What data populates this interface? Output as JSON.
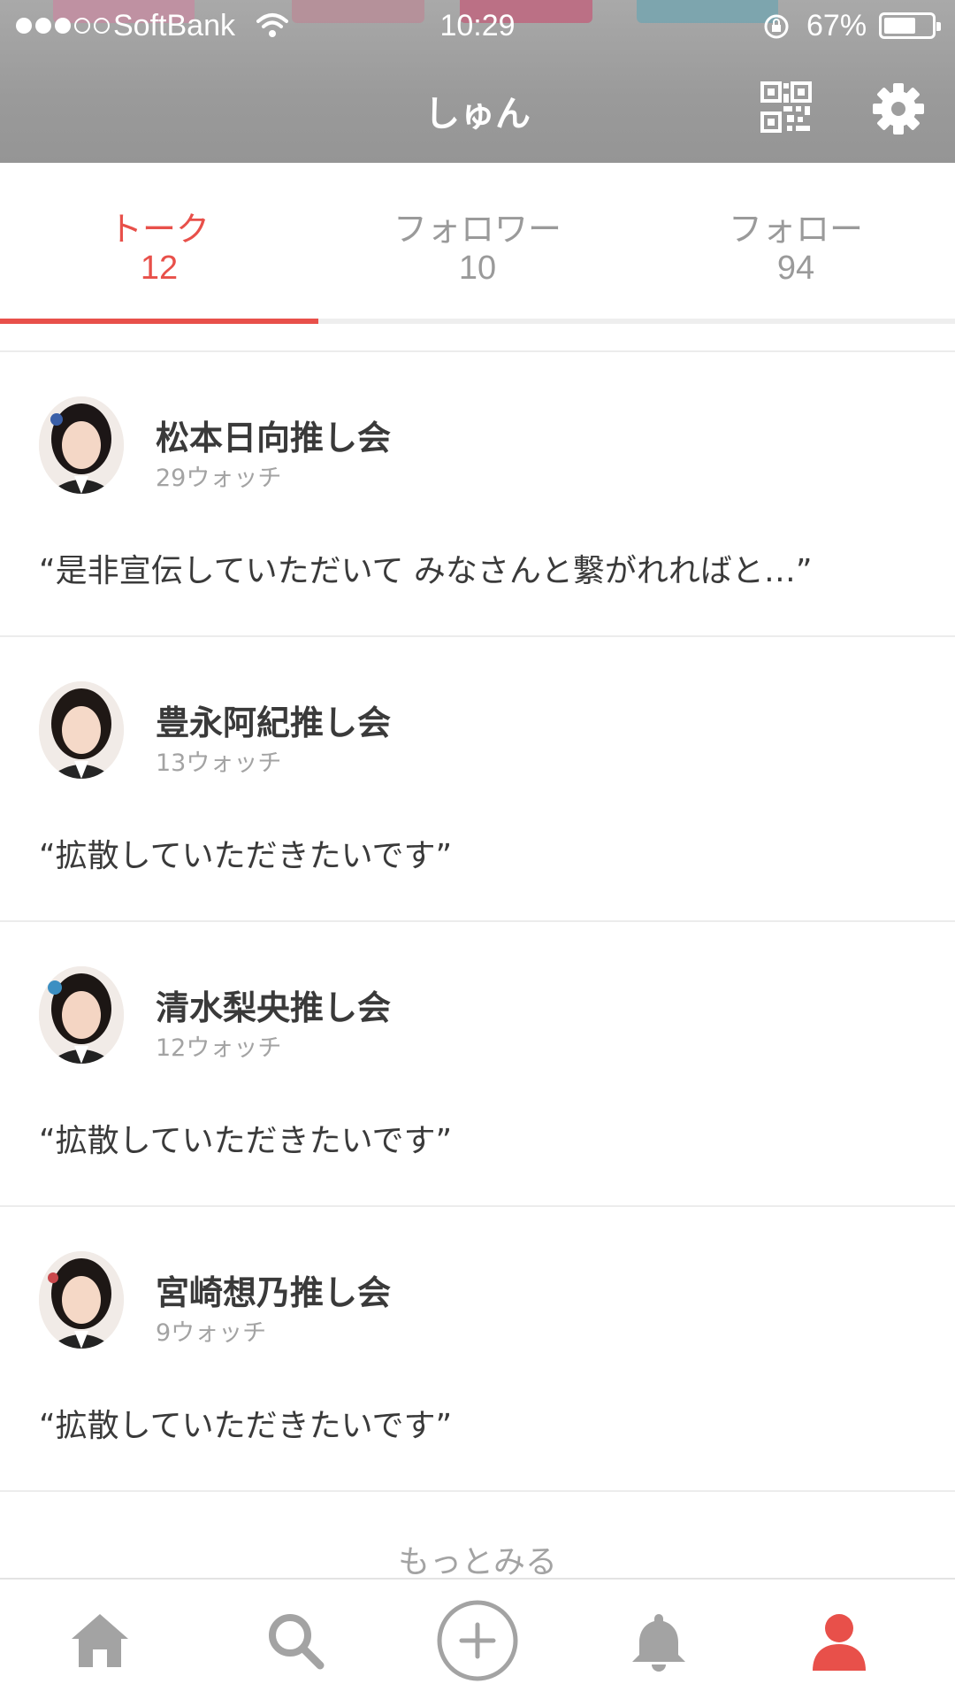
{
  "status_bar": {
    "carrier": "SoftBank",
    "time": "10:29",
    "battery": "67%",
    "battery_level": 0.67,
    "signal_bars": 3
  },
  "header": {
    "title": "しゅん",
    "qr_icon": "qr-code-icon",
    "settings_icon": "gear-icon"
  },
  "tabs": [
    {
      "label": "トーク",
      "count": "12",
      "active": true
    },
    {
      "label": "フォロワー",
      "count": "10",
      "active": false
    },
    {
      "label": "フォロー",
      "count": "94",
      "active": false
    }
  ],
  "talks": [
    {
      "name": "松本日向推し会",
      "watch": "29ウォッチ",
      "quote": "“是非宣伝していただいて みなさんと繋がれればと…”"
    },
    {
      "name": "豊永阿紀推し会",
      "watch": "13ウォッチ",
      "quote": "“拡散していただきたいです”"
    },
    {
      "name": "清水梨央推し会",
      "watch": "12ウォッチ",
      "quote": "“拡散していただきたいです”"
    },
    {
      "name": "宮崎想乃推し会",
      "watch": "9ウォッチ",
      "quote": "“拡散していただきたいです”"
    }
  ],
  "more_label": "もっとみる",
  "bottom_nav": [
    {
      "icon": "home-icon"
    },
    {
      "icon": "search-icon"
    },
    {
      "icon": "add-circle-icon"
    },
    {
      "icon": "bell-icon"
    },
    {
      "icon": "profile-icon",
      "active": true
    }
  ],
  "colors": {
    "accent": "#e8504a",
    "inactive": "#9a9a9a",
    "header_bg": "#9e9e9e"
  }
}
